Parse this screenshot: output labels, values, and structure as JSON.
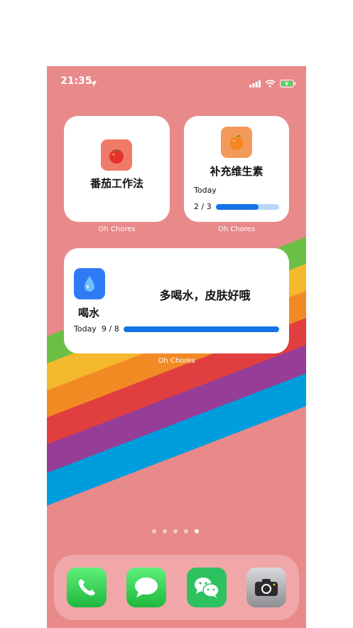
{
  "status_bar": {
    "time": "21:35",
    "icons": [
      "location-arrow-icon",
      "cellular-signal-icon",
      "wifi-icon",
      "battery-charging-icon"
    ]
  },
  "widgets": {
    "tomato": {
      "icon": "tomato-icon",
      "title": "番茄工作法",
      "caption": "Oh Chores",
      "icon_bg": "#f07a6a"
    },
    "vitamin": {
      "icon": "orange-icon",
      "title": "补充维生素",
      "today_label": "Today",
      "progress_text": "2 / 3",
      "progress": 0.67,
      "caption": "Oh Chores",
      "icon_bg": "#f39a5a"
    },
    "water": {
      "icon": "water-drop-icon",
      "name": "喝水",
      "message": "多喝水，皮肤好哦",
      "today_label": "Today",
      "progress_text": "9 / 8",
      "progress": 1.0,
      "caption": "Oh Chores",
      "icon_bg": "#2f7bf6"
    }
  },
  "page_indicator": {
    "count": 5,
    "active_index": 4
  },
  "dock": {
    "apps": [
      {
        "icon": "phone-icon",
        "color": "#34c759"
      },
      {
        "icon": "messages-icon",
        "color": "#34c759"
      },
      {
        "icon": "wechat-icon",
        "color": "#2dc160"
      },
      {
        "icon": "camera-icon",
        "color": "#8e8e93"
      }
    ]
  },
  "colors": {
    "wallpaper": "#e8898a",
    "accent_blue": "#1473e6",
    "rainbow": [
      "#6cbf45",
      "#f5b92d",
      "#f28a24",
      "#e03e3f",
      "#963d97",
      "#009ddc"
    ]
  }
}
